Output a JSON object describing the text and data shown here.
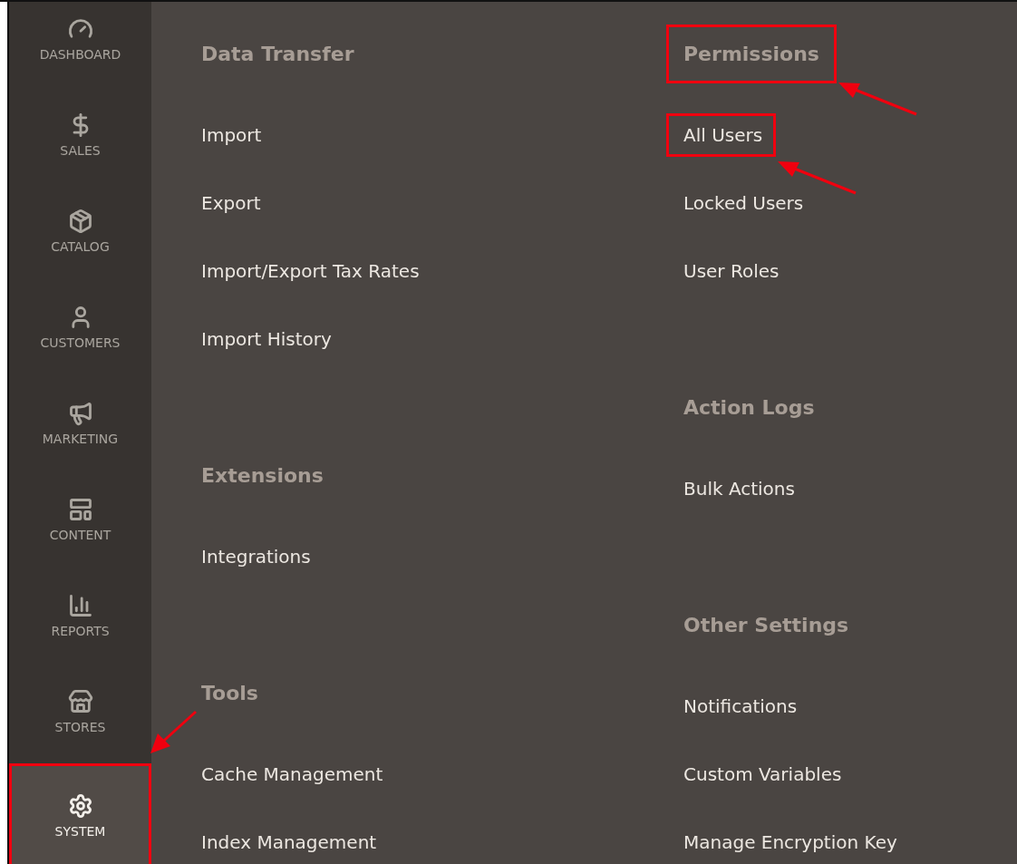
{
  "sidebar": {
    "items": [
      {
        "label": "DASHBOARD",
        "selected": false,
        "highlighted": false
      },
      {
        "label": "SALES",
        "selected": false,
        "highlighted": false
      },
      {
        "label": "CATALOG",
        "selected": false,
        "highlighted": false
      },
      {
        "label": "CUSTOMERS",
        "selected": false,
        "highlighted": false
      },
      {
        "label": "MARKETING",
        "selected": false,
        "highlighted": false
      },
      {
        "label": "CONTENT",
        "selected": false,
        "highlighted": false
      },
      {
        "label": "REPORTS",
        "selected": false,
        "highlighted": false
      },
      {
        "label": "STORES",
        "selected": false,
        "highlighted": false
      },
      {
        "label": "SYSTEM",
        "selected": true,
        "highlighted": true
      }
    ]
  },
  "menu": {
    "columns": [
      {
        "sections": [
          {
            "title": "Data Transfer",
            "highlighted": false,
            "items": [
              {
                "label": "Import",
                "highlighted": false
              },
              {
                "label": "Export",
                "highlighted": false
              },
              {
                "label": "Import/Export Tax Rates",
                "highlighted": false
              },
              {
                "label": "Import History",
                "highlighted": false
              }
            ]
          },
          {
            "title": "Extensions",
            "highlighted": false,
            "items": [
              {
                "label": "Integrations",
                "highlighted": false
              }
            ]
          },
          {
            "title": "Tools",
            "highlighted": false,
            "items": [
              {
                "label": "Cache Management",
                "highlighted": false
              },
              {
                "label": "Index Management",
                "highlighted": false
              }
            ]
          }
        ]
      },
      {
        "sections": [
          {
            "title": "Permissions",
            "highlighted": true,
            "items": [
              {
                "label": "All Users",
                "highlighted": true
              },
              {
                "label": "Locked Users",
                "highlighted": false
              },
              {
                "label": "User Roles",
                "highlighted": false
              }
            ]
          },
          {
            "title": "Action Logs",
            "highlighted": false,
            "items": [
              {
                "label": "Bulk Actions",
                "highlighted": false
              }
            ]
          },
          {
            "title": "Other Settings",
            "highlighted": false,
            "items": [
              {
                "label": "Notifications",
                "highlighted": false
              },
              {
                "label": "Custom Variables",
                "highlighted": false
              },
              {
                "label": "Manage Encryption Key",
                "highlighted": false
              }
            ]
          }
        ]
      }
    ]
  }
}
